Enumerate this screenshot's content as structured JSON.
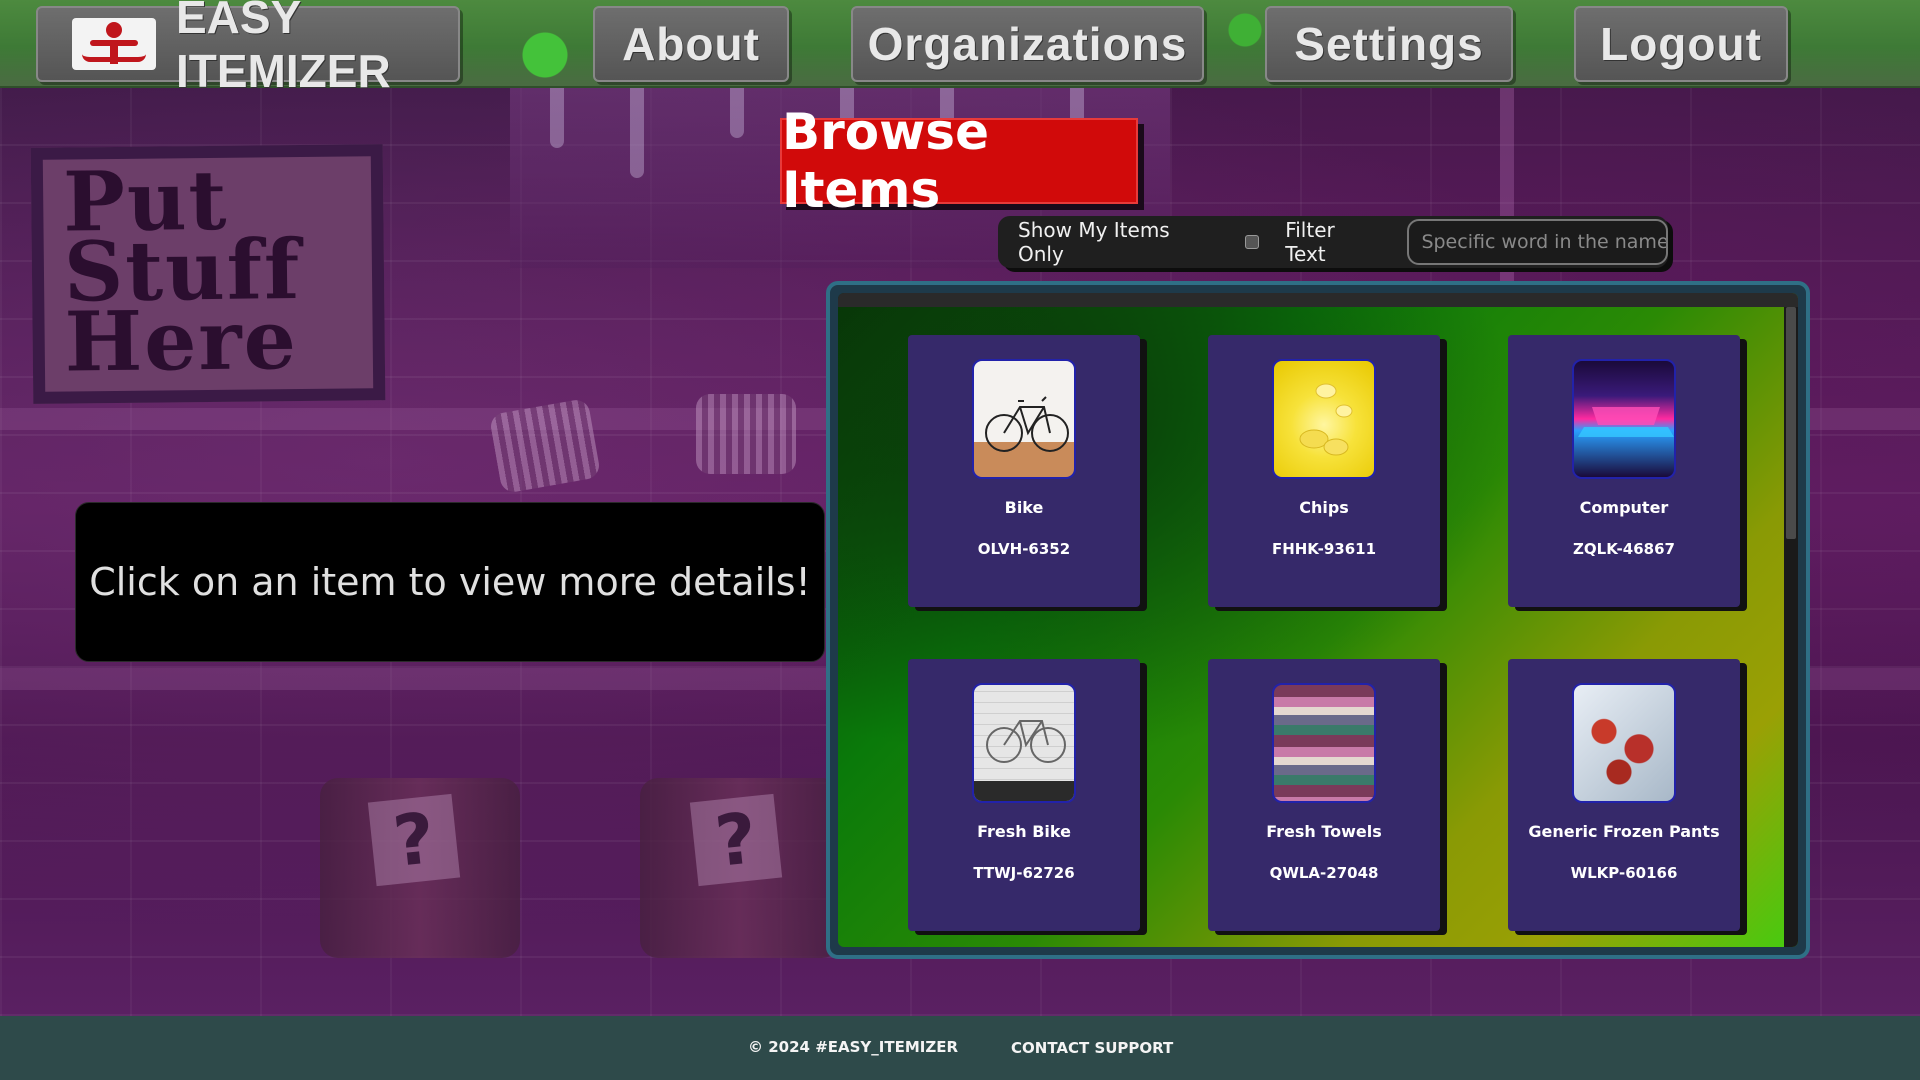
{
  "nav": {
    "brand": "EASY ITEMIZER",
    "items": [
      {
        "label": "About"
      },
      {
        "label": "Organizations"
      },
      {
        "label": "Settings"
      },
      {
        "label": "Logout"
      }
    ]
  },
  "background": {
    "sign_text": [
      "Put",
      "Stuff",
      "Here"
    ],
    "barrel_marks": [
      "?",
      "?"
    ]
  },
  "page": {
    "title": "Browse Items",
    "info_message": "Click on an item to view more details!"
  },
  "filters": {
    "show_mine_label": "Show My Items Only",
    "show_mine_checked": false,
    "filter_text_label": "Filter Text",
    "filter_placeholder": "Specific word in the name.",
    "filter_value": ""
  },
  "items": [
    {
      "name": "Bike",
      "code": "OLVH-6352",
      "thumb": "bike-photo"
    },
    {
      "name": "Chips",
      "code": "FHHK-93611",
      "thumb": "chips-photo"
    },
    {
      "name": "Computer",
      "code": "ZQLK-46867",
      "thumb": "laptop-photo"
    },
    {
      "name": "Fresh Bike",
      "code": "TTWJ-62726",
      "thumb": "bike-on-wall-photo"
    },
    {
      "name": "Fresh Towels",
      "code": "QWLA-27048",
      "thumb": "towels-photo"
    },
    {
      "name": "Generic Frozen Pants",
      "code": "WLKP-60166",
      "thumb": "frozen-berries-photo"
    }
  ],
  "footer": {
    "copyright": "© 2024 #EASY_ITEMIZER",
    "contact": "CONTACT SUPPORT"
  },
  "colors": {
    "title_bg": "#d10a0a",
    "card_bg": "#36296a",
    "footer_bg": "#2e4a4a",
    "nav_btn_bg": "#5f5f5f"
  }
}
